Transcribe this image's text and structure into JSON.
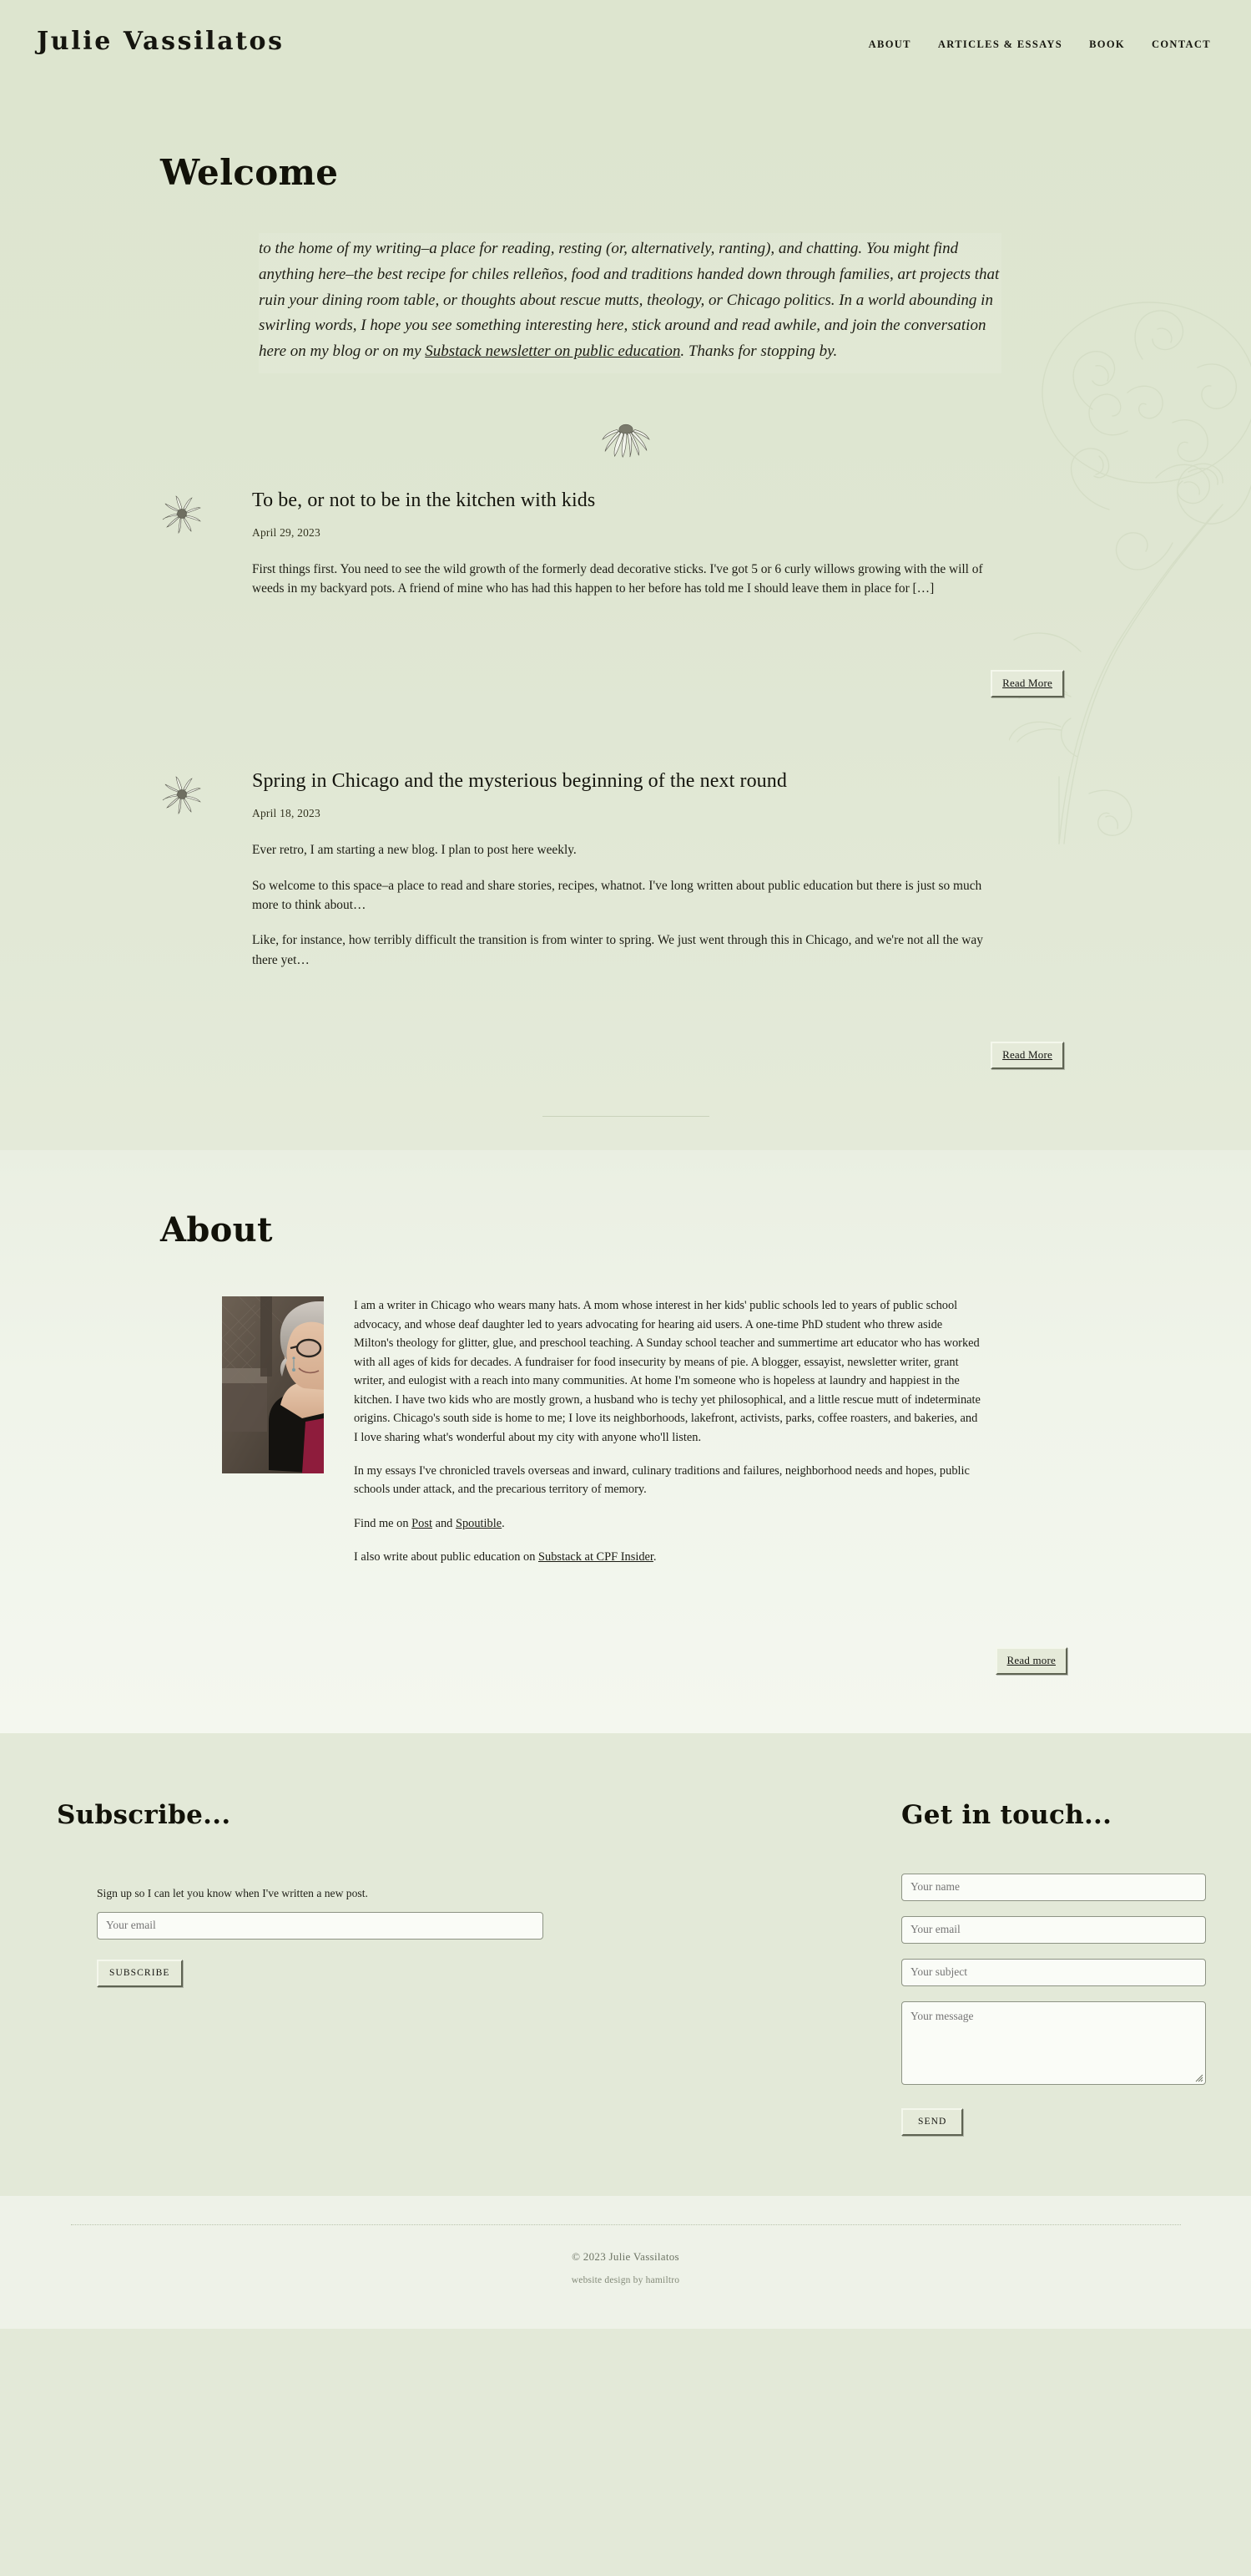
{
  "site": {
    "title": "Julie Vassilatos",
    "nav": [
      {
        "label": "ABOUT",
        "name": "about"
      },
      {
        "label": "ARTICLES & ESSAYS",
        "name": "articles-essays"
      },
      {
        "label": "BOOK",
        "name": "book"
      },
      {
        "label": "CONTACT",
        "name": "contact"
      }
    ]
  },
  "welcome": {
    "heading": "Welcome",
    "intro_part1": "to the home of my writing–a place for reading, resting (or, alternatively, ranting), and chatting. You might find anything here–the best recipe for chiles relleños, food and traditions handed down through families, art projects that ruin your dining room table, or thoughts about rescue mutts, theology, or Chicago politics. In a world abounding in swirling words, I hope you see something interesting here, stick around and read awhile, and join the conversation here on my blog or on my ",
    "intro_link": "Substack newsletter on public education",
    "intro_part2": ". Thanks for stopping by."
  },
  "posts": [
    {
      "title": "To be, or not to be in the kitchen with kids",
      "date": "April 29, 2023",
      "paragraphs": [
        "First things first.  You need to see the wild growth of the formerly dead decorative sticks. I've got 5 or 6 curly willows growing with the will of weeds in my backyard pots. A friend of mine who has had this happen to her before has told me I should leave them in place for […]"
      ],
      "button": "Read More"
    },
    {
      "title": "Spring in Chicago and the mysterious beginning of the next round",
      "date": "April 18, 2023",
      "paragraphs": [
        "Ever retro, I am starting a new blog. I plan to post here weekly.",
        "So welcome to this space–a place to read and share stories, recipes, whatnot. I've long written about public education but there is just so much more to think about…",
        "Like, for instance, how terribly difficult the transition is from winter to spring. We just went through this in Chicago, and we're not all the way there yet…"
      ],
      "button": "Read More"
    }
  ],
  "about": {
    "heading": "About",
    "bio_p1": "I am a writer in Chicago who wears many hats. A mom whose interest in her kids' public schools led to years of public school advocacy, and whose deaf daughter led to years advocating for hearing aid users. A one-time PhD student who threw aside Milton's theology for glitter, glue, and preschool teaching. A Sunday school teacher and summertime art educator who has worked with all ages of kids for decades. A fundraiser for food insecurity by means of pie. A blogger, essayist, newsletter writer, grant writer, and eulogist with a reach into many communities. At home I'm someone who is hopeless at laundry and happiest in the kitchen. I have two kids who are mostly grown, a husband who is techy yet philosophical, and a little rescue mutt of indeterminate origins. Chicago's south side is home to me; I love its neighborhoods, lakefront, activists, parks, coffee roasters, and bakeries, and I love sharing what's wonderful about my city with anyone who'll listen.",
    "bio_p2": "In my essays I've chronicled travels overseas and inward, culinary traditions and failures, neighborhood needs and hopes, public schools under attack, and the precarious territory of memory.",
    "find_me_prefix": "Find me on ",
    "find_me_link1": "Post",
    "find_me_mid": " and ",
    "find_me_link2": "Spoutible",
    "find_me_suffix": ".",
    "substack_prefix": "I also write about public education on ",
    "substack_link": "Substack at CPF Insider",
    "substack_suffix": ".",
    "button": "Read more",
    "portrait_alt": "Portrait of Julie Vassilatos"
  },
  "subscribe": {
    "heading": "Subscribe...",
    "note": "Sign up so I can let you know when I've written a new post.",
    "email_placeholder": "Your email",
    "button": "SUBSCRIBE"
  },
  "contact": {
    "heading": "Get in touch...",
    "name_placeholder": "Your name",
    "email_placeholder": "Your email",
    "subject_placeholder": "Your subject",
    "message_placeholder": "Your message",
    "button": "SEND"
  },
  "footer": {
    "copyright": "© 2023 Julie Vassilatos",
    "credit": "website design by hamiltro"
  },
  "colors": {
    "page_bg": "#e3e9d8",
    "header_bg": "#dde5cf",
    "about_bg": "#f2f5ec",
    "text": "#1c1c18",
    "muted": "#6d7464"
  }
}
